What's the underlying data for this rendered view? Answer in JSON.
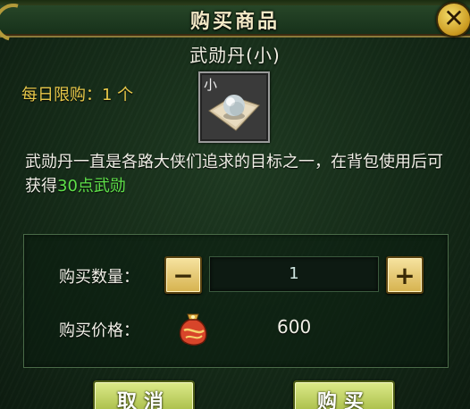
{
  "dialog": {
    "title": "购买商品",
    "close_icon": "close-x-icon"
  },
  "item": {
    "name": "武勋丹(小)",
    "daily_limit": "每日限购：1 个",
    "icon_tag": "小",
    "icon_name": "pill-on-cloth-icon",
    "description_prefix": "武勋丹一直是各路大侠们追求的目标之一，在背包使用后可获得",
    "description_highlight": "30点武勋"
  },
  "purchase": {
    "quantity_label": "购买数量：",
    "decrement_label": "−",
    "quantity_value": "1",
    "increment_label": "+",
    "price_label": "购买价格：",
    "price_icon": "currency-pouch-icon",
    "price_value": "600"
  },
  "buttons": {
    "cancel_label": "取消",
    "buy_label": "购买"
  },
  "colors": {
    "background": "#142a17",
    "gold_text": "#e8c94a",
    "highlight_green": "#5fe14a",
    "button_green": "#9fb43a",
    "stepper_gold": "#d6b24e"
  }
}
